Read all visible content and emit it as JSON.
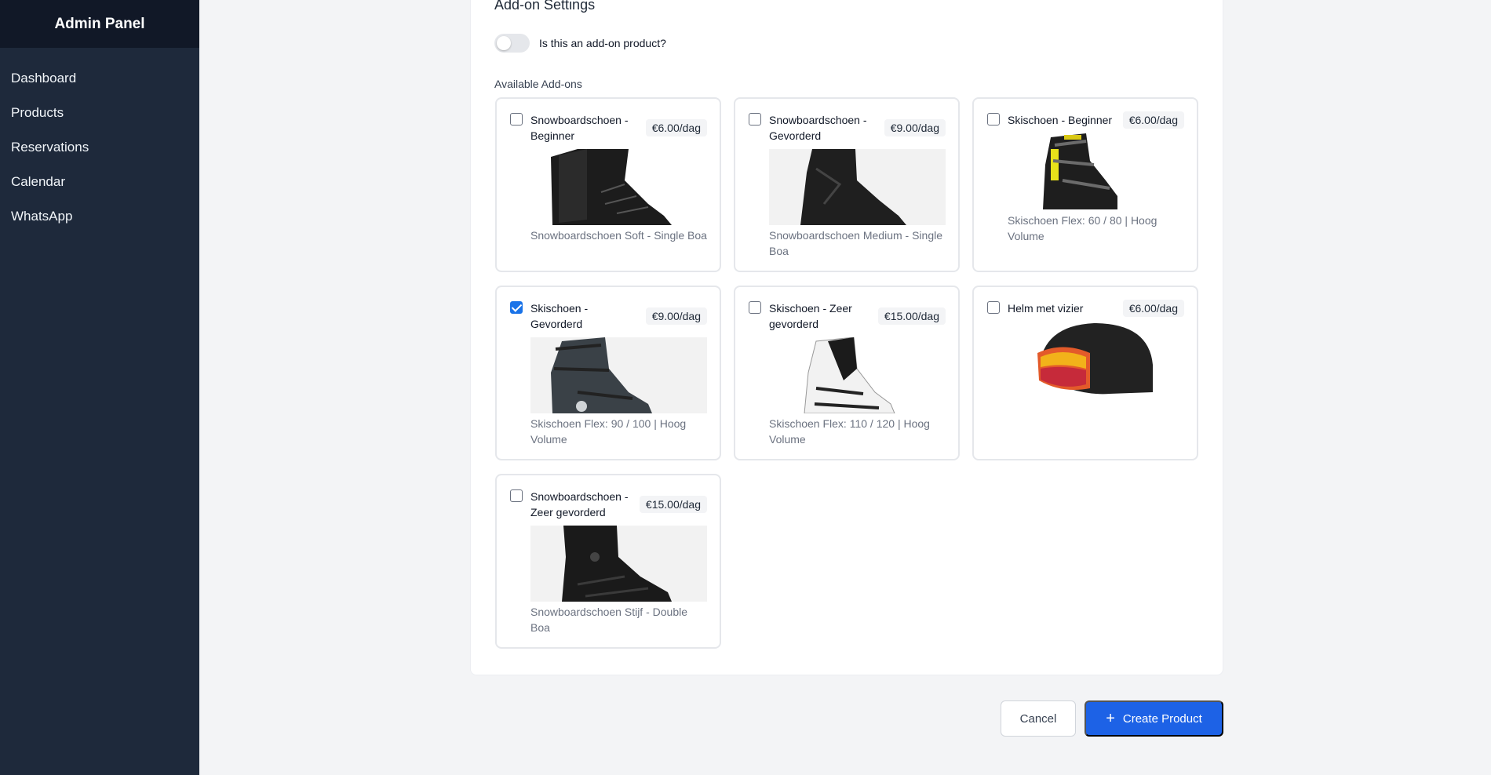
{
  "sidebar": {
    "title": "Admin Panel",
    "items": [
      {
        "label": "Dashboard"
      },
      {
        "label": "Products"
      },
      {
        "label": "Reservations"
      },
      {
        "label": "Calendar"
      },
      {
        "label": "WhatsApp"
      }
    ]
  },
  "addon_settings": {
    "title": "Add-on Settings",
    "toggle_label": "Is this an add-on product?",
    "toggle_on": false,
    "available_label": "Available Add-ons"
  },
  "addons": [
    {
      "name": "Snowboardschoen - Beginner",
      "price": "€6.00/dag",
      "description": "Snowboardschoen Soft - Single Boa",
      "checked": false,
      "icon": "snowboard-boot"
    },
    {
      "name": "Snowboardschoen - Gevorderd",
      "price": "€9.00/dag",
      "description": "Snowboardschoen Medium - Single Boa",
      "checked": false,
      "icon": "snowboard-boot"
    },
    {
      "name": "Skischoen - Beginner",
      "price": "€6.00/dag",
      "description": "Skischoen Flex: 60 / 80 | Hoog Volume",
      "checked": false,
      "icon": "ski-boot"
    },
    {
      "name": "Skischoen - Gevorderd",
      "price": "€9.00/dag",
      "description": "Skischoen Flex: 90 / 100 | Hoog Volume",
      "checked": true,
      "icon": "ski-boot"
    },
    {
      "name": "Skischoen - Zeer gevorderd",
      "price": "€15.00/dag",
      "description": "Skischoen Flex: 110 / 120 | Hoog Volume",
      "checked": false,
      "icon": "ski-boot"
    },
    {
      "name": "Helm met vizier",
      "price": "€6.00/dag",
      "description": "",
      "checked": false,
      "icon": "helmet"
    },
    {
      "name": "Snowboardschoen - Zeer gevorderd",
      "price": "€15.00/dag",
      "description": "Snowboardschoen Stijf - Double Boa",
      "checked": false,
      "icon": "snowboard-boot"
    }
  ],
  "actions": {
    "cancel_label": "Cancel",
    "create_label": "Create Product",
    "primary_color": "#1d62e6"
  }
}
